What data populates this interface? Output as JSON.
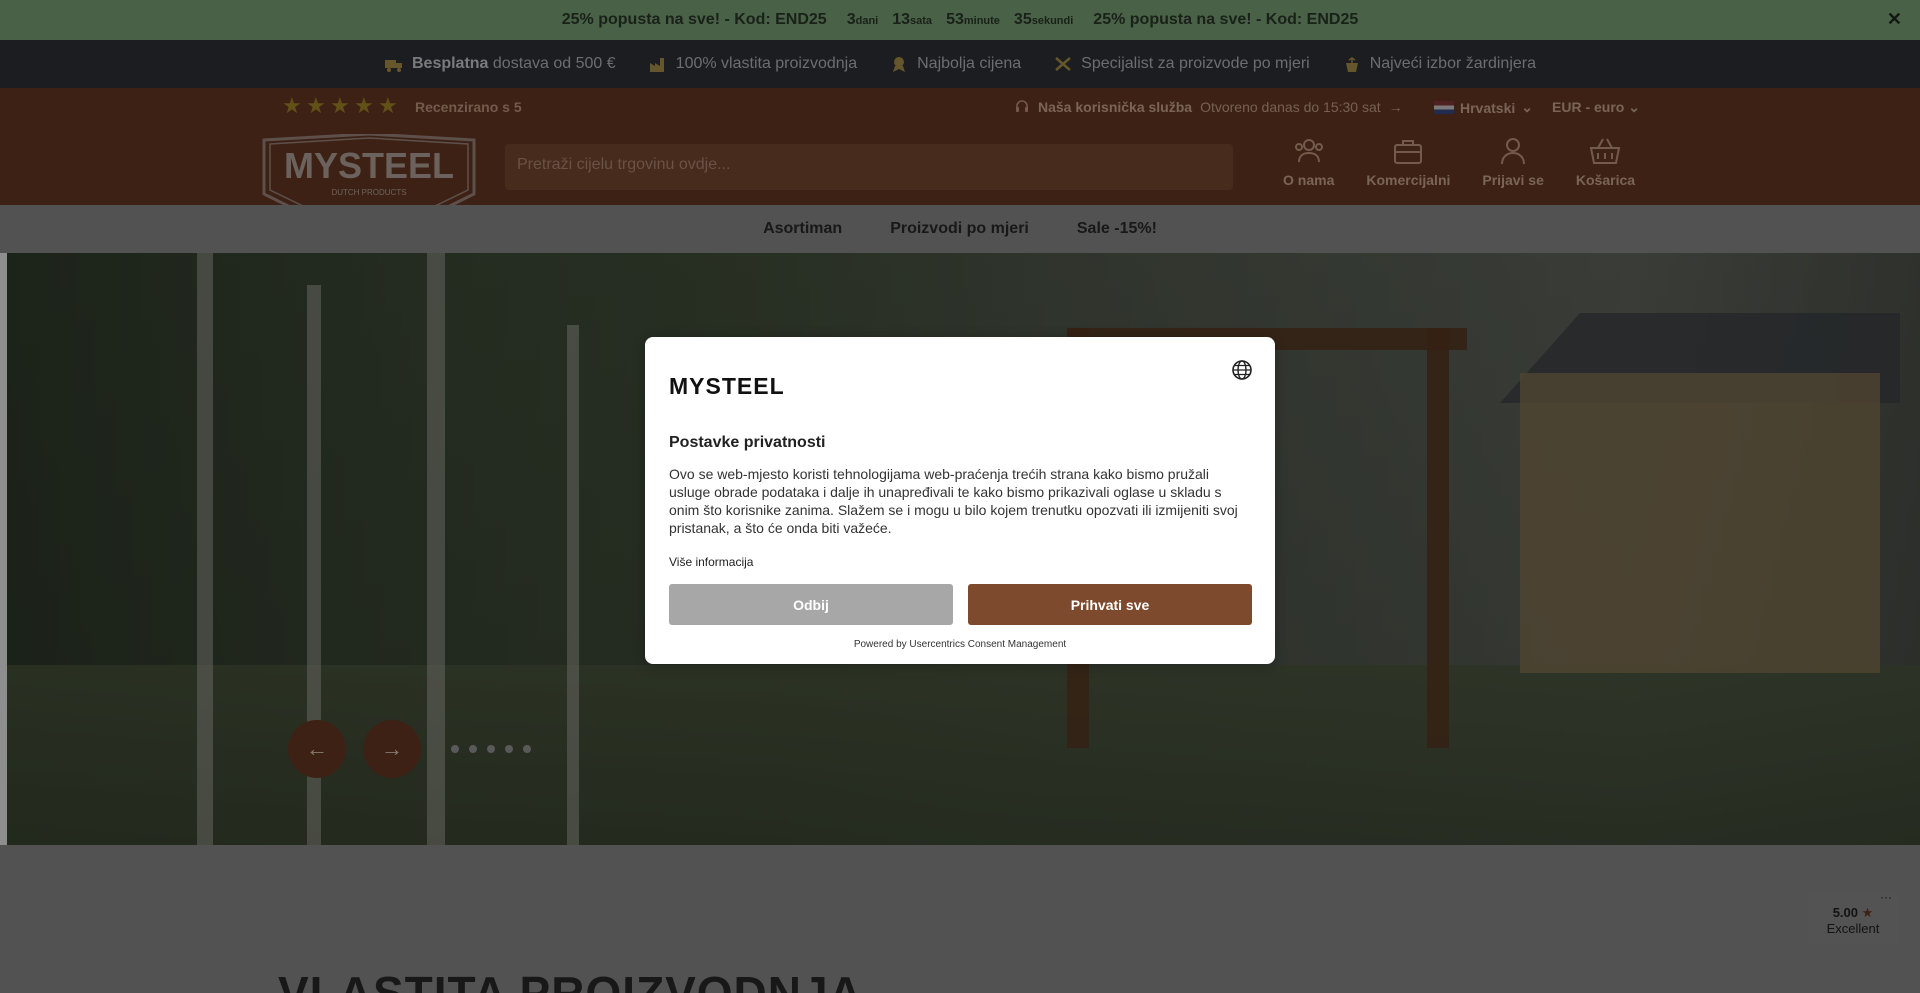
{
  "promo": {
    "text_left": "25% popusta na sve! - Kod: END25",
    "text_right": "25% popusta na sve! - Kod: END25",
    "timer": [
      {
        "value": "3",
        "unit": "dani"
      },
      {
        "value": "13",
        "unit": "sata"
      },
      {
        "value": "53",
        "unit": "minute"
      },
      {
        "value": "35",
        "unit": "sekundi"
      }
    ],
    "close_icon": "close-icon"
  },
  "usp": {
    "items": [
      {
        "bold": "Besplatna",
        "text": " dostava od 500 €",
        "icon": "truck-icon"
      },
      {
        "bold": "",
        "text": "100% vlastita proizvodnja",
        "icon": "factory-icon"
      },
      {
        "bold": "",
        "text": "Najbolja cijena",
        "icon": "award-icon"
      },
      {
        "bold": "",
        "text": "Specijalist za proizvode po mjeri",
        "icon": "tools-icon"
      },
      {
        "bold": "",
        "text": "Najveći izbor žardinjera",
        "icon": "planter-icon"
      }
    ]
  },
  "header": {
    "reviewed": "Recenzirano s 5",
    "service_label": "Naša korisnička služba",
    "service_hours": "Otvoreno danas do 15:30 sat",
    "service_arrow": "→",
    "language": "Hrvatski",
    "currency": "EUR - euro",
    "logo_text": "MYSTEEL",
    "logo_sub": "DUTCH PRODUCTS",
    "search_placeholder": "Pretraži cijelu trgovinu ovdje...",
    "icons": [
      {
        "label": "O nama",
        "icon": "people-icon"
      },
      {
        "label": "Komercijalni",
        "icon": "briefcase-icon"
      },
      {
        "label": "Prijavi se",
        "icon": "user-icon"
      },
      {
        "label": "Košarica",
        "icon": "basket-icon"
      }
    ]
  },
  "nav": {
    "items": [
      "Asortiman",
      "Proizvodi po mjeri",
      "Sale -15%!"
    ]
  },
  "hero": {
    "prev": "←",
    "next": "→",
    "dots": 5
  },
  "section": {
    "title": "VLASTITA PROIZVODNJA"
  },
  "trust": {
    "score": "5.00",
    "label": "Excellent",
    "more": "···"
  },
  "modal": {
    "logo": "MYSTEEL",
    "title": "Postavke privatnosti",
    "description": "Ovo se web-mjesto koristi tehnologijama web-praćenja trećih strana kako bismo pružali usluge obrade podataka i dalje ih unapređivali te kako bismo prikazivali oglase u skladu s onim što korisnike zanima. Slažem se i mogu u bilo kojem trenutku opozvati ili izmijeniti svoj pristanak, a što će onda biti važeće.",
    "more_info": "Više informacija",
    "deny": "Odbij",
    "accept": "Prihvati sve",
    "powered": "Powered by Usercentrics Consent Management"
  },
  "colors": {
    "promo": "#7fa87a",
    "usp": "#2f3338",
    "header": "#6a3a24",
    "accent": "#7d4a2d"
  }
}
